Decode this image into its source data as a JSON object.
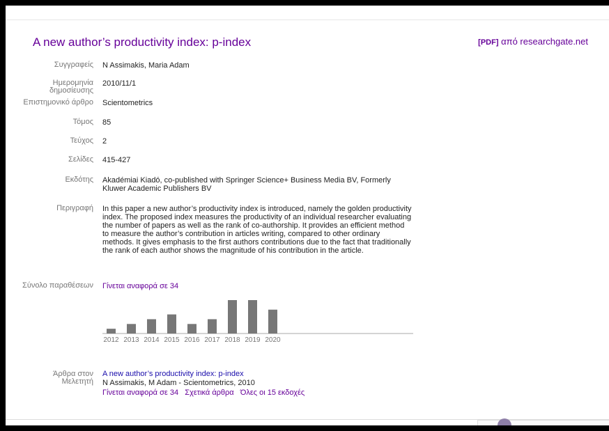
{
  "title": "A new author’s productivity index: p-index",
  "pdf": {
    "tag": "[PDF]",
    "text": "από researchgate.net"
  },
  "fields": {
    "authors": {
      "label": "Συγγραφείς",
      "value": "N Assimakis, Maria Adam"
    },
    "date": {
      "label": "Ημερομηνία δημοσίευσης",
      "value": "2010/11/1"
    },
    "journal": {
      "label": "Επιστημονικό άρθρο",
      "value": "Scientometrics"
    },
    "volume": {
      "label": "Τόμος",
      "value": "85"
    },
    "issue": {
      "label": "Τεύχος",
      "value": "2"
    },
    "pages": {
      "label": "Σελίδες",
      "value": "415-427"
    },
    "publisher": {
      "label": "Εκδότης",
      "value": "Akadémiai Kiadó, co-published with Springer Science+ Business Media BV, Formerly Kluwer Academic Publishers BV"
    },
    "description": {
      "label": "Περιγραφή",
      "value": "In this paper a new author’s productivity index is introduced, namely the golden productivity index. The proposed index measures the productivity of an individual researcher evaluating the number of papers as well as the rank of co-authorship. It provides an efficient method to measure the author’s contribution in articles writing, compared to other ordinary methods. It gives emphasis to the first authors contributions due to the fact that traditionally the rank of each author shows the magnitude of his contribution in the article."
    },
    "citations": {
      "label": "Σύνολο παραθέσεων",
      "value": "Γίνεται αναφορά σε 34"
    }
  },
  "chart_data": {
    "type": "bar",
    "categories": [
      "2012",
      "2013",
      "2014",
      "2015",
      "2016",
      "2017",
      "2018",
      "2019",
      "2020"
    ],
    "values": [
      1,
      2,
      3,
      4,
      2,
      3,
      7,
      7,
      5
    ],
    "color": "#777777"
  },
  "scholar": {
    "label": "Άρθρα στον Μελετητή",
    "title": "A new author’s productivity index: p-index",
    "meta": "N Assimakis, M Adam - Scientometrics, 2010",
    "links": [
      "Γίνεται αναφορά σε 34",
      "Σχετικά άρθρα",
      "Όλες οι 15 εκδοχές"
    ]
  }
}
